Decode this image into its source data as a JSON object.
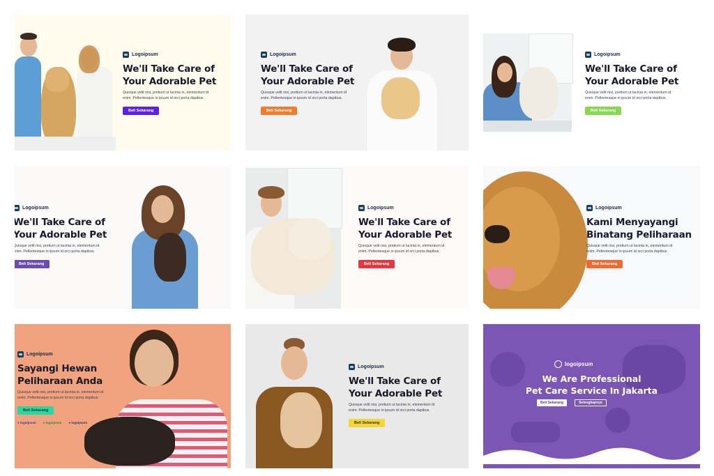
{
  "brand": "Logoipsum",
  "brand_lower": "logoipsum",
  "heading_default": [
    "We'll Take Care of",
    "Your Adorable Pet"
  ],
  "body_default": [
    "Quisque velit nisi, pretium ut lacinia in, elementum id",
    "enim. Pellentesque in ipsum id orci porta dapibus."
  ],
  "button_default": "Beli Sekarang",
  "cards": [
    {
      "button_color": "#5b21e6"
    },
    {
      "button_color": "#ef7c2f"
    },
    {
      "button_color": "#86d852"
    },
    {
      "button_color": "#6d4bb3"
    },
    {
      "button_color": "#e7363d"
    },
    {
      "heading": [
        "Kami Menyayangi",
        "Binatang Peliharaan"
      ],
      "button_color": "#ef6a2f"
    },
    {
      "heading": [
        "Sayangi Hewan",
        "Peliharaan Anda"
      ],
      "button_color": "#2ad7a0",
      "partner_logos": [
        "logoipsum",
        "logoipsum",
        "logoipsum"
      ]
    },
    {
      "button_color": "#f2d63a"
    },
    {
      "heading": [
        "We Are Professional",
        "Pet Care Service In Jakarta"
      ],
      "button_primary": "Beli Sekarang",
      "button_secondary": "Selengkapnya",
      "bg_color": "#7b56b5"
    }
  ]
}
